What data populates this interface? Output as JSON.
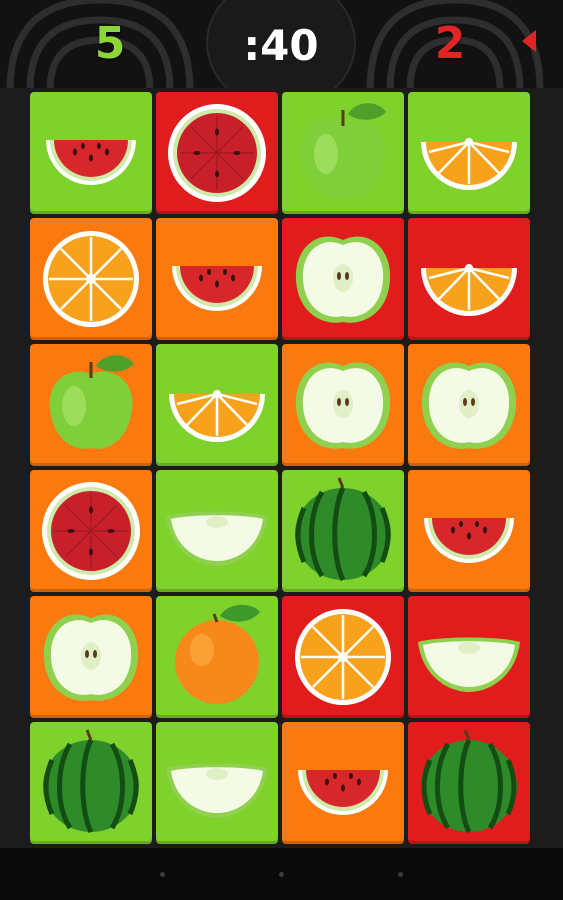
{
  "header": {
    "left_score": "5",
    "right_score": "2",
    "timer": ":40"
  },
  "colors": {
    "green_tile": "#7fd12b",
    "red_tile": "#e01c1c",
    "orange_tile": "#fa7a0f",
    "left_score": "#8cd63a",
    "right_score": "#e02525"
  },
  "board": {
    "columns": 4,
    "rows": 6,
    "tiles": [
      {
        "bg": "green",
        "fruit": "watermelon-slice"
      },
      {
        "bg": "red",
        "fruit": "watermelon-round"
      },
      {
        "bg": "green",
        "fruit": "green-apple"
      },
      {
        "bg": "green",
        "fruit": "orange-slice"
      },
      {
        "bg": "orange",
        "fruit": "orange-round"
      },
      {
        "bg": "orange",
        "fruit": "watermelon-slice"
      },
      {
        "bg": "red",
        "fruit": "apple-half"
      },
      {
        "bg": "red",
        "fruit": "orange-slice"
      },
      {
        "bg": "orange",
        "fruit": "green-apple"
      },
      {
        "bg": "green",
        "fruit": "orange-slice"
      },
      {
        "bg": "orange",
        "fruit": "apple-half"
      },
      {
        "bg": "orange",
        "fruit": "apple-half"
      },
      {
        "bg": "orange",
        "fruit": "watermelon-round"
      },
      {
        "bg": "green",
        "fruit": "apple-slice"
      },
      {
        "bg": "green",
        "fruit": "whole-watermelon"
      },
      {
        "bg": "orange",
        "fruit": "watermelon-slice"
      },
      {
        "bg": "orange",
        "fruit": "apple-half"
      },
      {
        "bg": "green",
        "fruit": "whole-orange"
      },
      {
        "bg": "red",
        "fruit": "orange-round"
      },
      {
        "bg": "red",
        "fruit": "apple-slice"
      },
      {
        "bg": "green",
        "fruit": "whole-watermelon"
      },
      {
        "bg": "green",
        "fruit": "apple-slice"
      },
      {
        "bg": "orange",
        "fruit": "watermelon-slice"
      },
      {
        "bg": "red",
        "fruit": "whole-watermelon"
      }
    ]
  }
}
